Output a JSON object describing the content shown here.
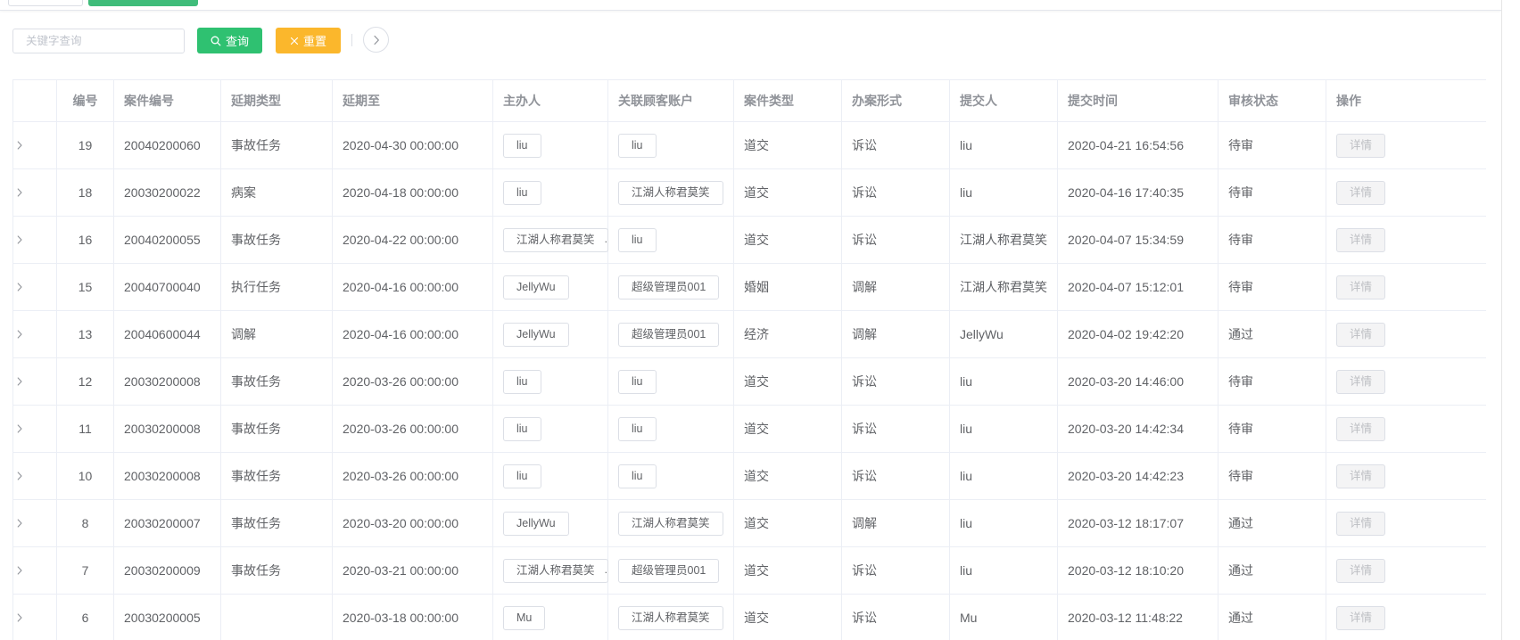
{
  "search": {
    "placeholder": "关键字查询"
  },
  "toolbar": {
    "query_label": "查询",
    "query_icon": "search-icon",
    "reset_label": "重置",
    "reset_icon": "close-icon",
    "toggle_icon": "chevron-right-icon"
  },
  "colors": {
    "primary": "#2fc171",
    "warning": "#fbb72c",
    "text": "#606266",
    "header_text": "#909399",
    "border": "#ebeef5",
    "disabled_button_bg": "#f4f4f5"
  },
  "table": {
    "expand_icon": "chevron-right-icon",
    "columns": [
      "编号",
      "案件编号",
      "延期类型",
      "延期至",
      "主办人",
      "关联顾客账户",
      "案件类型",
      "办案形式",
      "提交人",
      "提交时间",
      "审核状态",
      "操作"
    ],
    "action_label": "详情",
    "rows": [
      {
        "id": "19",
        "case_no": "20040200060",
        "delay_type": "事故任务",
        "delay_until": "2020-04-30 00:00:00",
        "host": [
          "liu"
        ],
        "accounts": [
          "liu"
        ],
        "case_type": "道交",
        "handling": "诉讼",
        "submitter": "liu",
        "submit_time": "2020-04-21 16:54:56",
        "status": "待审"
      },
      {
        "id": "18",
        "case_no": "20030200022",
        "delay_type": "病案",
        "delay_until": "2020-04-18 00:00:00",
        "host": [
          "liu"
        ],
        "accounts": [
          "江湖人称君莫笑"
        ],
        "case_type": "道交",
        "handling": "诉讼",
        "submitter": "liu",
        "submit_time": "2020-04-16 17:40:35",
        "status": "待审"
      },
      {
        "id": "16",
        "case_no": "20040200055",
        "delay_type": "事故任务",
        "delay_until": "2020-04-22 00:00:00",
        "host": [
          "江湖人称君莫笑"
        ],
        "accounts": [
          "liu"
        ],
        "case_type": "道交",
        "handling": "诉讼",
        "submitter": "江湖人称君莫笑",
        "submit_time": "2020-04-07 15:34:59",
        "status": "待审"
      },
      {
        "id": "15",
        "case_no": "20040700040",
        "delay_type": "执行任务",
        "delay_until": "2020-04-16 00:00:00",
        "host": [
          "JellyWu"
        ],
        "accounts": [
          "超级管理员001"
        ],
        "case_type": "婚姻",
        "handling": "调解",
        "submitter": "江湖人称君莫笑",
        "submit_time": "2020-04-07 15:12:01",
        "status": "待审"
      },
      {
        "id": "13",
        "case_no": "20040600044",
        "delay_type": "调解",
        "delay_until": "2020-04-16 00:00:00",
        "host": [
          "JellyWu"
        ],
        "accounts": [
          "超级管理员001"
        ],
        "case_type": "经济",
        "handling": "调解",
        "submitter": "JellyWu",
        "submit_time": "2020-04-02 19:42:20",
        "status": "通过"
      },
      {
        "id": "12",
        "case_no": "20030200008",
        "delay_type": "事故任务",
        "delay_until": "2020-03-26 00:00:00",
        "host": [
          "liu"
        ],
        "accounts": [
          "liu"
        ],
        "case_type": "道交",
        "handling": "诉讼",
        "submitter": "liu",
        "submit_time": "2020-03-20 14:46:00",
        "status": "待审"
      },
      {
        "id": "11",
        "case_no": "20030200008",
        "delay_type": "事故任务",
        "delay_until": "2020-03-26 00:00:00",
        "host": [
          "liu"
        ],
        "accounts": [
          "liu"
        ],
        "case_type": "道交",
        "handling": "诉讼",
        "submitter": "liu",
        "submit_time": "2020-03-20 14:42:34",
        "status": "待审"
      },
      {
        "id": "10",
        "case_no": "20030200008",
        "delay_type": "事故任务",
        "delay_until": "2020-03-26 00:00:00",
        "host": [
          "liu"
        ],
        "accounts": [
          "liu"
        ],
        "case_type": "道交",
        "handling": "诉讼",
        "submitter": "liu",
        "submit_time": "2020-03-20 14:42:23",
        "status": "待审"
      },
      {
        "id": "8",
        "case_no": "20030200007",
        "delay_type": "事故任务",
        "delay_until": "2020-03-20 00:00:00",
        "host": [
          "JellyWu"
        ],
        "accounts": [
          "江湖人称君莫笑"
        ],
        "case_type": "道交",
        "handling": "调解",
        "submitter": "liu",
        "submit_time": "2020-03-12 18:17:07",
        "status": "通过"
      },
      {
        "id": "7",
        "case_no": "20030200009",
        "delay_type": "事故任务",
        "delay_until": "2020-03-21 00:00:00",
        "host": [
          "江湖人称君莫笑"
        ],
        "accounts": [
          "超级管理员001"
        ],
        "case_type": "道交",
        "handling": "诉讼",
        "submitter": "liu",
        "submit_time": "2020-03-12 18:10:20",
        "status": "通过"
      },
      {
        "id": "6",
        "case_no": "20030200005",
        "delay_type": "",
        "delay_until": "2020-03-18 00:00:00",
        "host": [
          "Mu"
        ],
        "accounts": [
          "江湖人称君莫笑"
        ],
        "case_type": "道交",
        "handling": "诉讼",
        "submitter": "Mu",
        "submit_time": "2020-03-12 11:48:22",
        "status": "通过"
      }
    ]
  }
}
